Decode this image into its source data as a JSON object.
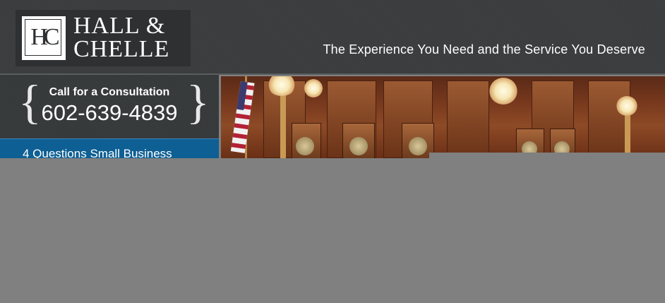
{
  "logo": {
    "monogram": "HC",
    "line1": "HALL &",
    "line2": "CHELLE"
  },
  "header": {
    "tagline": "The Experience You Need and the Service You Deserve"
  },
  "consultation": {
    "label": "Call for a Consultation",
    "phone": "602-639-4839"
  },
  "sidebar": {
    "question_link": "4 Questions Small Business"
  },
  "hero": {
    "image_description": "courtroom-photo"
  },
  "colors": {
    "header_bg": "#3a3c3d",
    "link_bar": "#0e5f93",
    "placeholder_gray": "#808080"
  }
}
